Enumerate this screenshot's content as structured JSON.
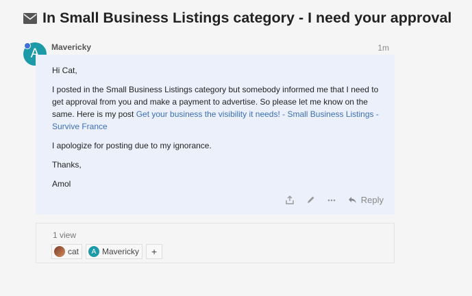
{
  "topic": {
    "title": "In Small Business Listings category - I need your approval",
    "icon": "envelope-icon"
  },
  "post": {
    "avatar_letter": "A",
    "avatar_color": "#1d9aa8",
    "username": "Mavericky",
    "time": "1m",
    "greeting": "Hi Cat,",
    "para1_text": "I posted in the Small Business Listings category but somebody informed me that I need to get approval from you and make a payment to advertise. So please let me know on the same. Here is my post ",
    "link_text": "Get your business the visibility it needs! - Small Business Listings - Survive France",
    "para2": "I apologize for posting due to my ignorance.",
    "thanks": "Thanks,",
    "signature": "Amol",
    "reply_label": "Reply"
  },
  "views": {
    "count_label": "1 view",
    "users": [
      {
        "name": "cat",
        "avatar": ""
      },
      {
        "name": "Mavericky",
        "avatar": "A"
      }
    ],
    "add_label": "+"
  },
  "colors": {
    "post_background": "#ebf0fb",
    "link": "#3b6fb6",
    "online_indicator": "#3f6fd6"
  }
}
